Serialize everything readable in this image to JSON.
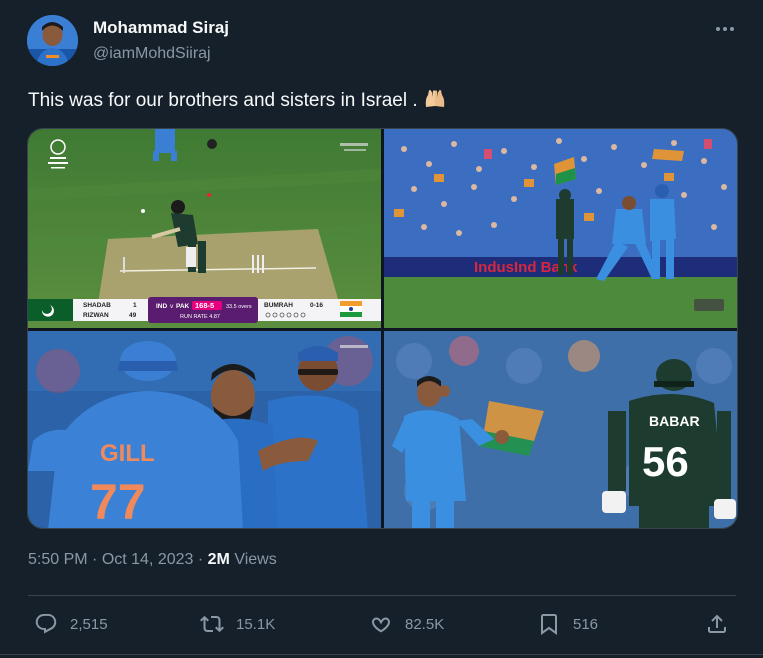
{
  "author": {
    "name": "Mohammad Siraj",
    "handle": "@iamMohdSiiraj"
  },
  "tweet": {
    "text": "This was for our brothers and sisters in Israel .",
    "emoji": "raised-hands"
  },
  "media": {
    "scoreboard": {
      "team1": "IND",
      "vs": "v",
      "team2": "PAK",
      "score": "168-5",
      "overs": "33.5 overs",
      "run_rate": "RUN RATE 4.87",
      "batter1": "SHADAB",
      "batter1_score": "1",
      "batter2": "RIZWAN",
      "batter2_score": "49",
      "bowler": "BUMRAH",
      "bowler_figures": "0-16"
    },
    "ad_text": "IndusInd Bank",
    "gill_name": "GILL",
    "gill_number": "77",
    "babar_name": "BABAR",
    "babar_number": "56"
  },
  "meta": {
    "time": "5:50 PM",
    "sep": " · ",
    "date": "Oct 14, 2023",
    "views_count": "2M",
    "views_label": "Views"
  },
  "actions": {
    "replies": "2,515",
    "reposts": "15.1K",
    "likes": "82.5K",
    "bookmarks": "516"
  },
  "colors": {
    "background": "#15202b",
    "text": "#f7f9f9",
    "secondary": "#8b98a5",
    "border": "#38444d"
  }
}
